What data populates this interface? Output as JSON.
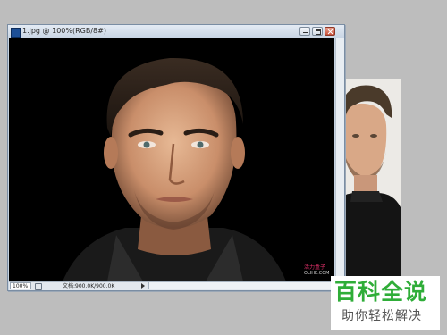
{
  "window": {
    "title": "1.jpg @ 100%(RGB/8#)",
    "app_icon": "photoshop-icon"
  },
  "status": {
    "zoom": "100%",
    "doc_info": "文档:900.0K/900.0K"
  },
  "canvas_watermark": {
    "line1": "活力盒子",
    "line2": "OLIHE.COM"
  },
  "logo": {
    "main": "百科全说",
    "sub": "助你轻松解决"
  },
  "colors": {
    "logo_green": "#2fad38",
    "titlebar": "#c7d4e3",
    "watermark": "#e0306a"
  }
}
